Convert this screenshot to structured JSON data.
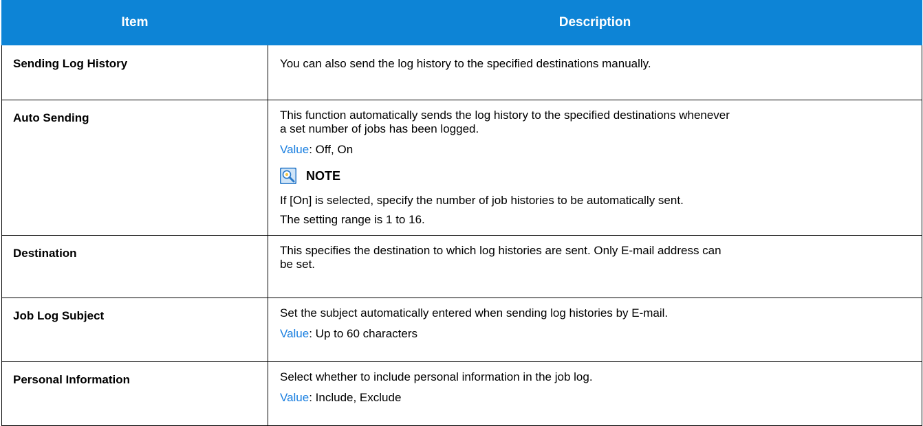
{
  "table": {
    "headers": {
      "item": "Item",
      "description": "Description"
    },
    "rows": [
      {
        "item": "Sending Log History",
        "desc": "You can also send the log history to the specified destinations manually."
      },
      {
        "item": "Auto Sending",
        "desc_line1": "This function automatically sends the log history to the specified destinations whenever",
        "desc_line2": "a set number of jobs has been logged.",
        "value_label": "Value",
        "value_text": ": Off, On",
        "note": {
          "icon": "note-icon",
          "title": "NOTE",
          "line1": "If [On] is selected, specify the number of job histories to be automatically sent.",
          "line2": "The setting range is 1 to 16."
        }
      },
      {
        "item": "Destination",
        "desc_line1": "This specifies the destination to which log histories are sent. Only E-mail address can",
        "desc_line2": "be set."
      },
      {
        "item": "Job Log Subject",
        "desc": "Set the subject automatically entered when sending log histories by E-mail.",
        "value_label": "Value",
        "value_text": ": Up to 60 characters"
      },
      {
        "item": "Personal Information",
        "desc": "Select whether to include personal information in the job log.",
        "value_label": "Value",
        "value_text": ": Include, Exclude"
      }
    ]
  },
  "colors": {
    "header_bg": "#0d84d6",
    "header_text": "#ffffff",
    "value_label": "#1a7fe0",
    "border": "#000000"
  }
}
